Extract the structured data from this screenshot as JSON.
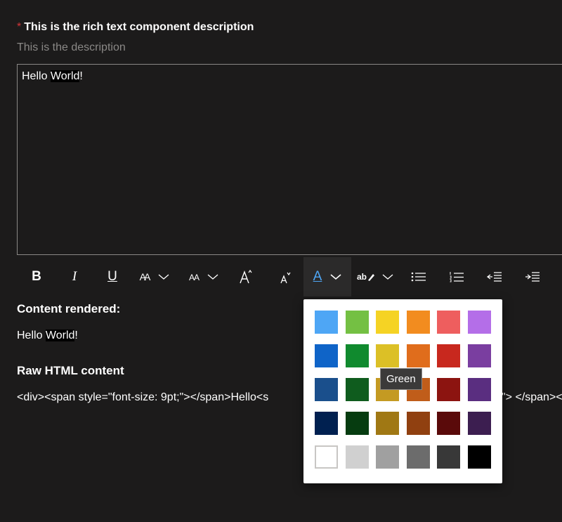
{
  "field": {
    "required_marker": "*",
    "label": "This is the rich text component description",
    "description": "This is the description"
  },
  "editor": {
    "text_before": "Hello ",
    "text_highlight": "World",
    "text_after": "!"
  },
  "toolbar": {
    "buttons": [
      {
        "name": "bold",
        "glyph": "B"
      },
      {
        "name": "italic",
        "glyph": "I"
      },
      {
        "name": "underline",
        "glyph": "U"
      },
      {
        "name": "font-family",
        "glyph": "AA"
      },
      {
        "name": "font-size",
        "glyph": "AA"
      },
      {
        "name": "grow-font",
        "glyph": "A"
      },
      {
        "name": "shrink-font",
        "glyph": "A"
      },
      {
        "name": "font-color",
        "glyph": "A"
      },
      {
        "name": "highlight",
        "glyph": "ab"
      }
    ],
    "icons": [
      "chevron-down-icon",
      "bullet-list-icon",
      "numbered-list-icon",
      "decrease-indent-icon",
      "increase-indent-icon"
    ]
  },
  "content_rendered": {
    "heading": "Content rendered:",
    "text_before": "Hello ",
    "text_highlight": "World",
    "text_after": "!"
  },
  "raw_html": {
    "heading": "Raw HTML content",
    "left_text": "<div><span style=\"font-size: 9pt;\"></span>Hello<s",
    "right_text": "\"> </span></div>"
  },
  "color_picker": {
    "tooltip": "Green",
    "swatches": [
      [
        "#4ea6f5",
        "#74c043",
        "#f5d324",
        "#f28c1f",
        "#ee5e5e",
        "#b46ee8"
      ],
      [
        "#0f64c8",
        "#108a2e",
        "#dcc026",
        "#e06d1c",
        "#c8281e",
        "#7a3ea0"
      ],
      [
        "#1a4f8c",
        "#0f5c1e",
        "#c49a22",
        "#c05d1a",
        "#8c1410",
        "#5a2e80"
      ],
      [
        "#002050",
        "#063c10",
        "#a07814",
        "#904010",
        "#5a0a0a",
        "#3c1e50"
      ],
      [
        "#ffffff",
        "#d0d0d0",
        "#a0a0a0",
        "#6c6c6c",
        "#383838",
        "#000000"
      ]
    ]
  }
}
